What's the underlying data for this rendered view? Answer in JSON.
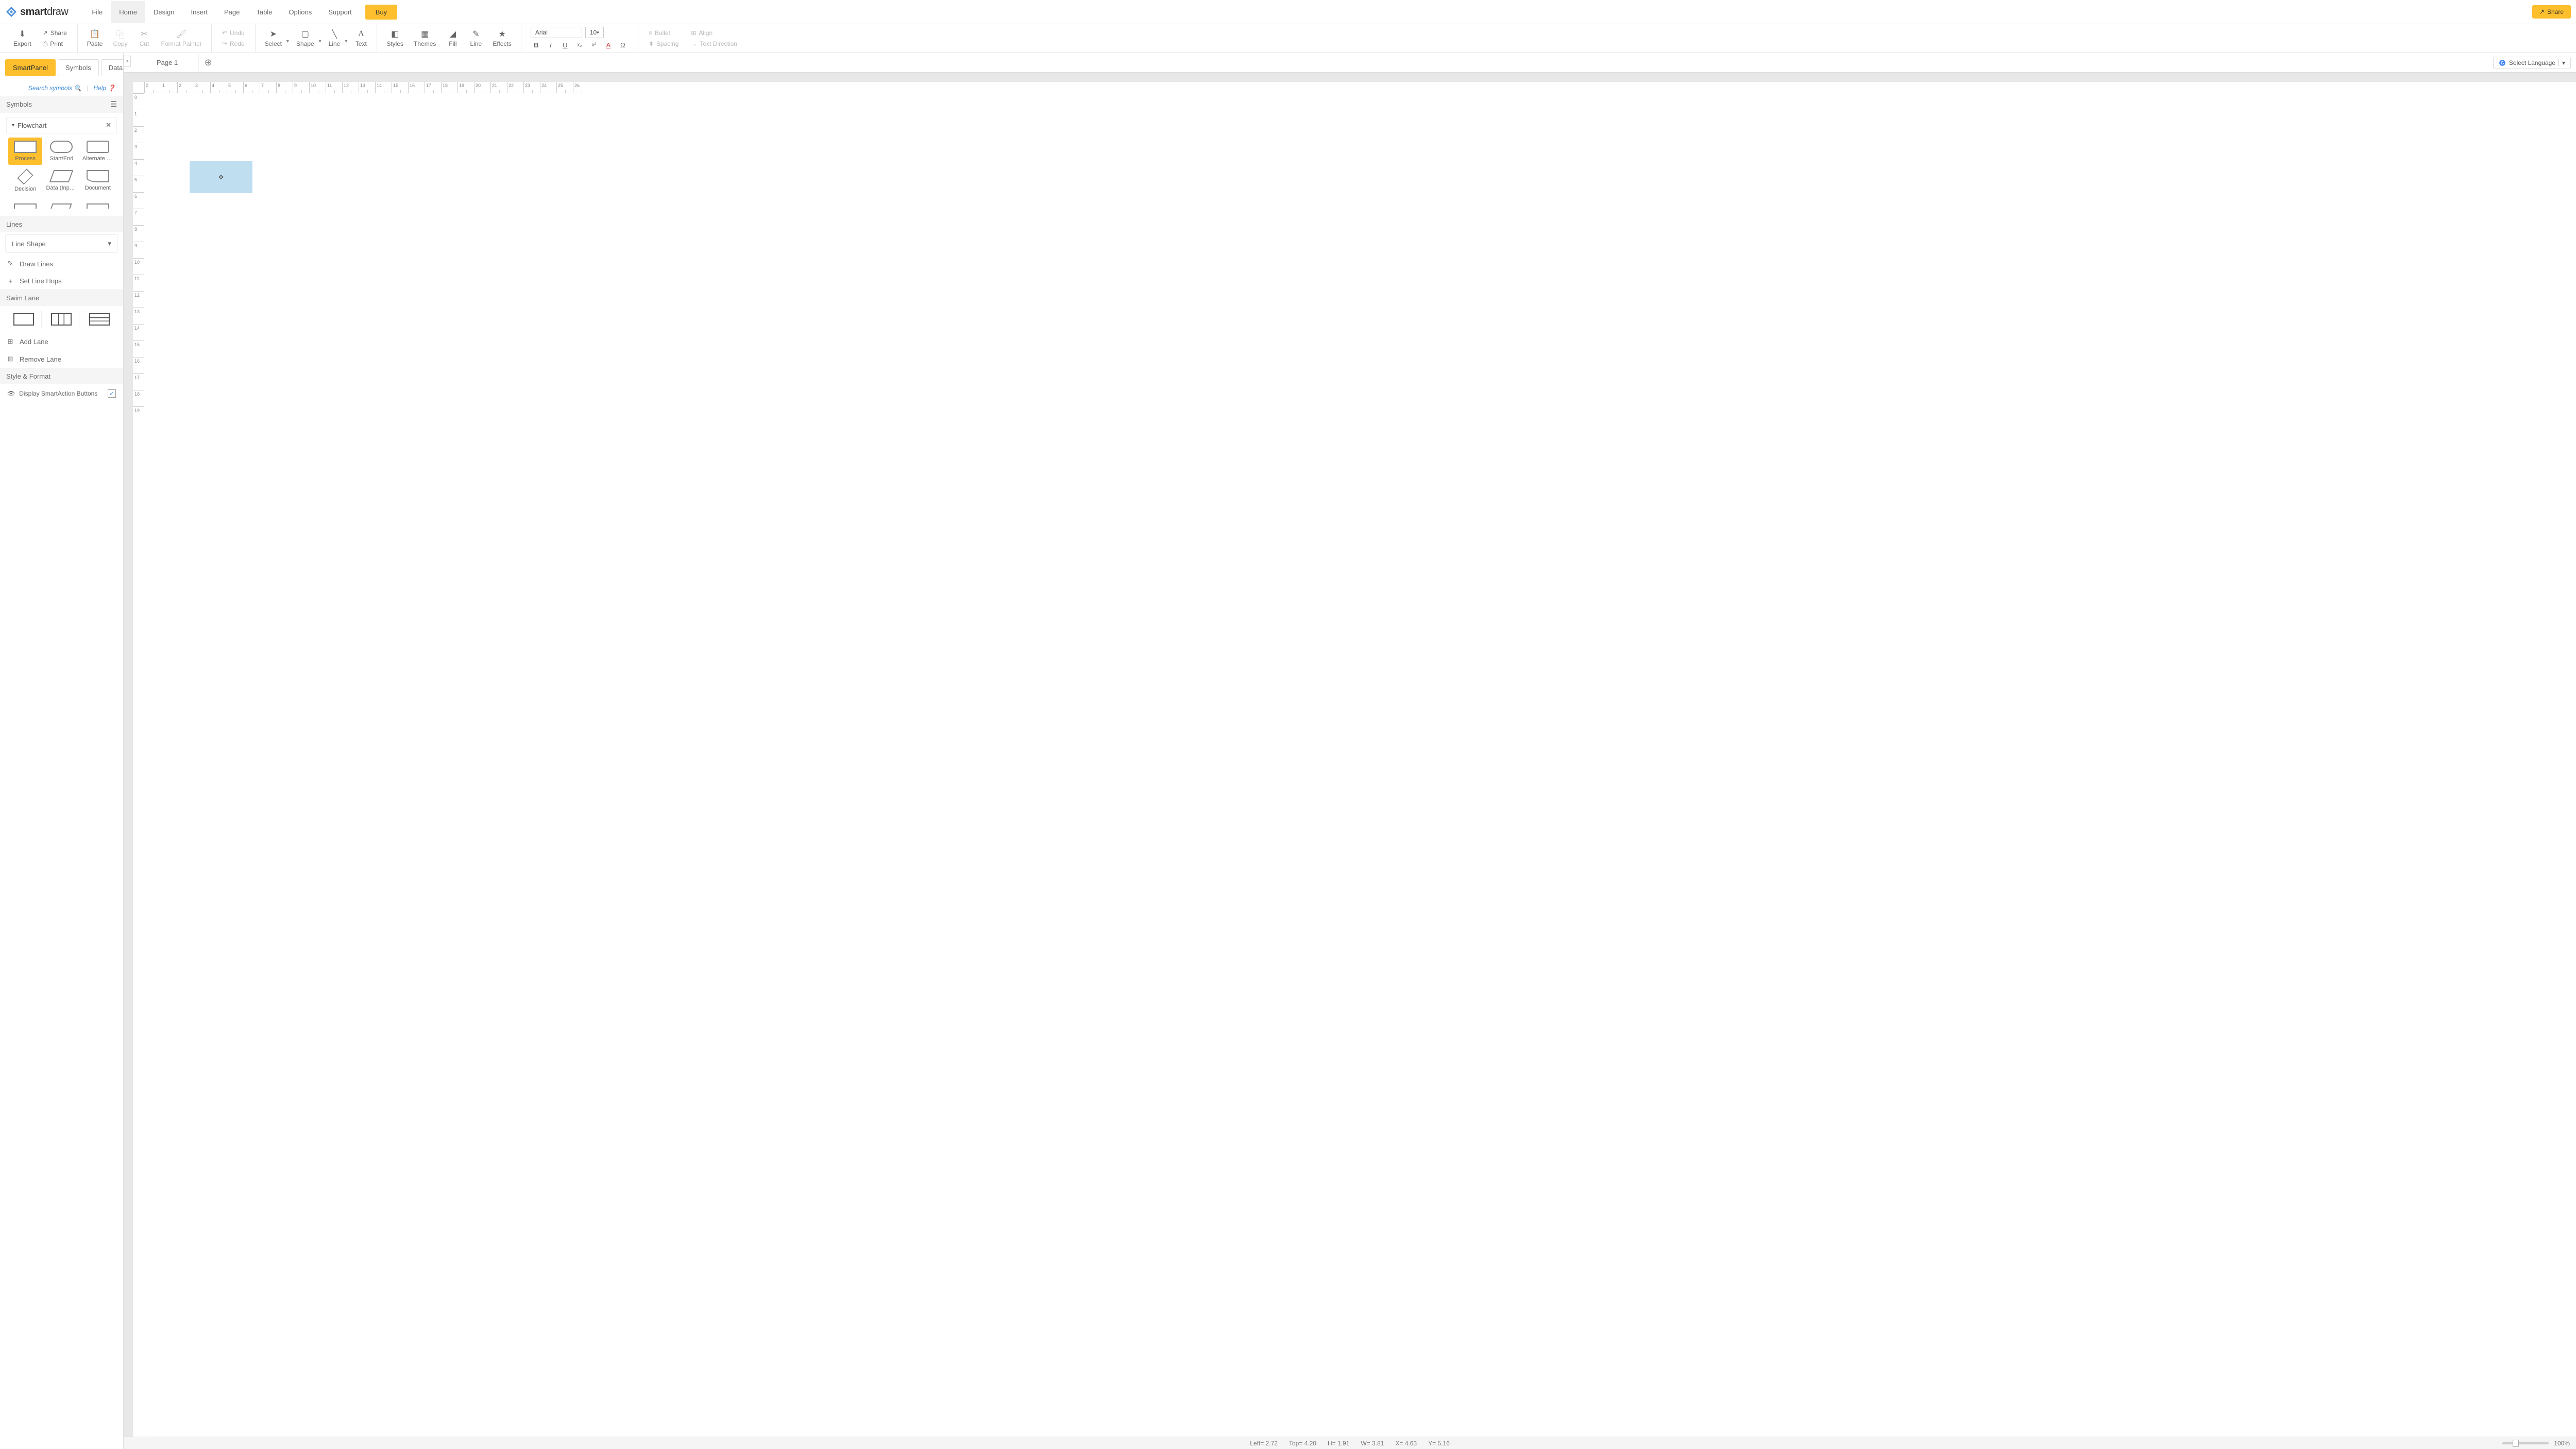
{
  "app": {
    "logo_text_1": "smart",
    "logo_text_2": "draw"
  },
  "menu": {
    "file": "File",
    "home": "Home",
    "design": "Design",
    "insert": "Insert",
    "page": "Page",
    "table": "Table",
    "options": "Options",
    "support": "Support",
    "buy": "Buy",
    "share": "Share"
  },
  "ribbon": {
    "export": "Export",
    "share_small": "Share",
    "print": "Print",
    "paste": "Paste",
    "copy": "Copy",
    "cut": "Cut",
    "format_painter": "Format Painter",
    "undo": "Undo",
    "redo": "Redo",
    "select": "Select",
    "shape": "Shape",
    "line": "Line",
    "text": "Text",
    "styles": "Styles",
    "themes": "Themes",
    "fill": "Fill",
    "line2": "Line",
    "effects": "Effects",
    "font": "Arial",
    "font_size": "10",
    "bullet": "Bullet",
    "align": "Align",
    "spacing": "Spacing",
    "text_direction": "Text Direction"
  },
  "sidebar": {
    "tabs": {
      "smartpanel": "SmartPanel",
      "symbols": "Symbols",
      "data": "Data"
    },
    "search": "Search symbols",
    "help": "Help",
    "symbols_header": "Symbols",
    "category": "Flowchart",
    "shapes": {
      "process": "Process",
      "start_end": "Start/End",
      "alternate": "Alternate Pr...",
      "decision": "Decision",
      "data_input": "Data (Input...",
      "document": "Document"
    },
    "lines_header": "Lines",
    "line_shape": "Line Shape",
    "draw_lines": "Draw Lines",
    "line_hops": "Set Line Hops",
    "swim_header": "Swim Lane",
    "add_lane": "Add Lane",
    "remove_lane": "Remove Lane",
    "style_header": "Style & Format",
    "smart_action": "Display SmartAction Buttons"
  },
  "canvas": {
    "collapse": ">",
    "page_tab": "Page 1",
    "lang": "Select Language",
    "status": {
      "left": "Left= 2.72",
      "top": "Top= 4.20",
      "h": "H= 1.91",
      "w": "W= 3.81",
      "x": "X= 4.63",
      "y": "Y= 5.16"
    },
    "zoom": "100%"
  }
}
